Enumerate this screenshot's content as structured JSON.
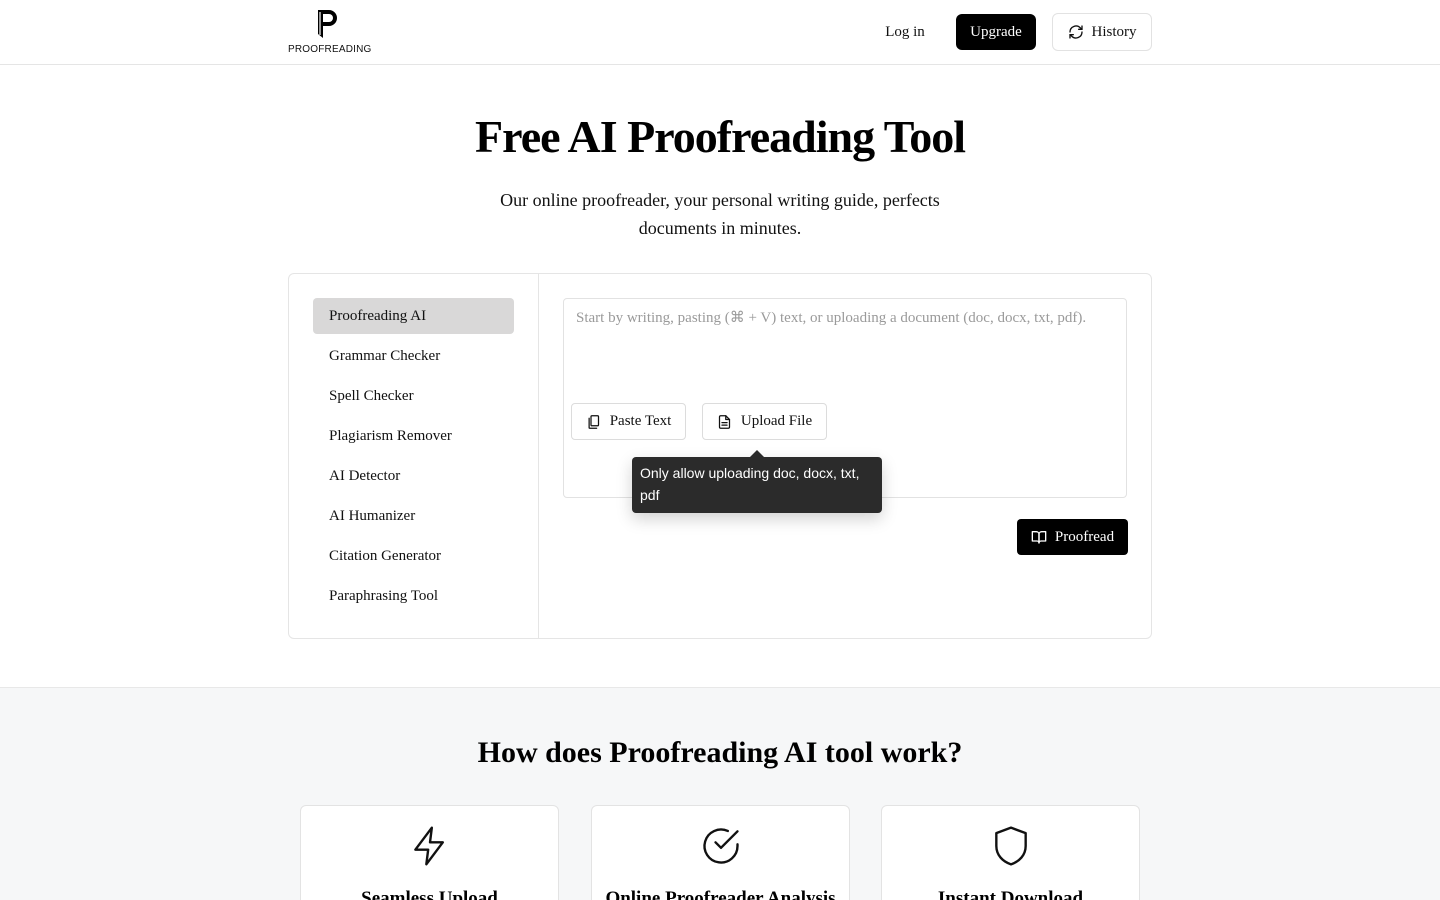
{
  "header": {
    "logo_text": "PROOFREADING",
    "login_label": "Log in",
    "upgrade_label": "Upgrade",
    "history_label": "History"
  },
  "hero": {
    "title": "Free AI Proofreading Tool",
    "subtitle": "Our online proofreader, your personal writing guide, perfects documents in minutes."
  },
  "sidebar": {
    "items": [
      {
        "label": "Proofreading AI",
        "active": true
      },
      {
        "label": "Grammar Checker",
        "active": false
      },
      {
        "label": "Spell Checker",
        "active": false
      },
      {
        "label": "Plagiarism Remover",
        "active": false
      },
      {
        "label": "AI Detector",
        "active": false
      },
      {
        "label": "AI Humanizer",
        "active": false
      },
      {
        "label": "Citation Generator",
        "active": false
      },
      {
        "label": "Paraphrasing Tool",
        "active": false
      }
    ]
  },
  "editor": {
    "placeholder": "Start by writing, pasting (⌘ + V) text, or uploading a document (doc, docx, txt, pdf).",
    "value": "",
    "paste_label": "Paste Text",
    "upload_label": "Upload File",
    "tooltip": "Only allow uploading doc, docx, txt, pdf",
    "proofread_label": "Proofread"
  },
  "how": {
    "title": "How does Proofreading AI tool work?",
    "cards": [
      {
        "icon": "lightning-icon",
        "title": "Seamless Upload"
      },
      {
        "icon": "check-circle-icon",
        "title": "Online Proofreader Analysis"
      },
      {
        "icon": "shield-icon",
        "title": "Instant Download"
      }
    ]
  },
  "colors": {
    "primary": "#000000",
    "active_item_bg": "#d9d8d8",
    "tooltip_bg": "#2b2b2b",
    "section_bg": "#f6f7f8",
    "border": "#e5e5e5"
  }
}
